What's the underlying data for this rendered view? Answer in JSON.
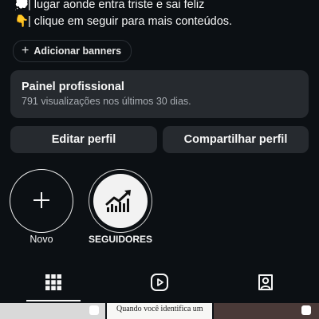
{
  "bio": {
    "line1": {
      "emoji": "💭",
      "text": "| lugar aonde entra triste e sai feliz"
    },
    "line2": {
      "emoji": "👇",
      "text": "| clique em seguir para mais conteúdos."
    }
  },
  "add_banners": {
    "icon": "plus-icon",
    "label": "Adicionar banners"
  },
  "professional_panel": {
    "title": "Painel profissional",
    "subtitle": "791 visualizações nos últimos 30 dias."
  },
  "actions": {
    "edit_profile": "Editar perfil",
    "share_profile": "Compartilhar perfil"
  },
  "highlights": [
    {
      "label": "Novo",
      "icon": "plus-icon"
    },
    {
      "label": "SEGUIDORES",
      "icon": "trending-up-chart-icon"
    }
  ],
  "tabs": [
    {
      "name": "posts-grid",
      "icon": "grid-icon",
      "active": true
    },
    {
      "name": "reels",
      "icon": "reels-play-icon",
      "active": false
    },
    {
      "name": "tagged",
      "icon": "tagged-person-icon",
      "active": false
    }
  ],
  "grid_posts": [
    {
      "caption": ""
    },
    {
      "caption": "Quando você identifica um"
    },
    {
      "caption": ""
    }
  ],
  "colors": {
    "background": "#0c1014",
    "card": "#262a2f",
    "text": "#f5f5f5",
    "muted": "#a8adb3"
  }
}
